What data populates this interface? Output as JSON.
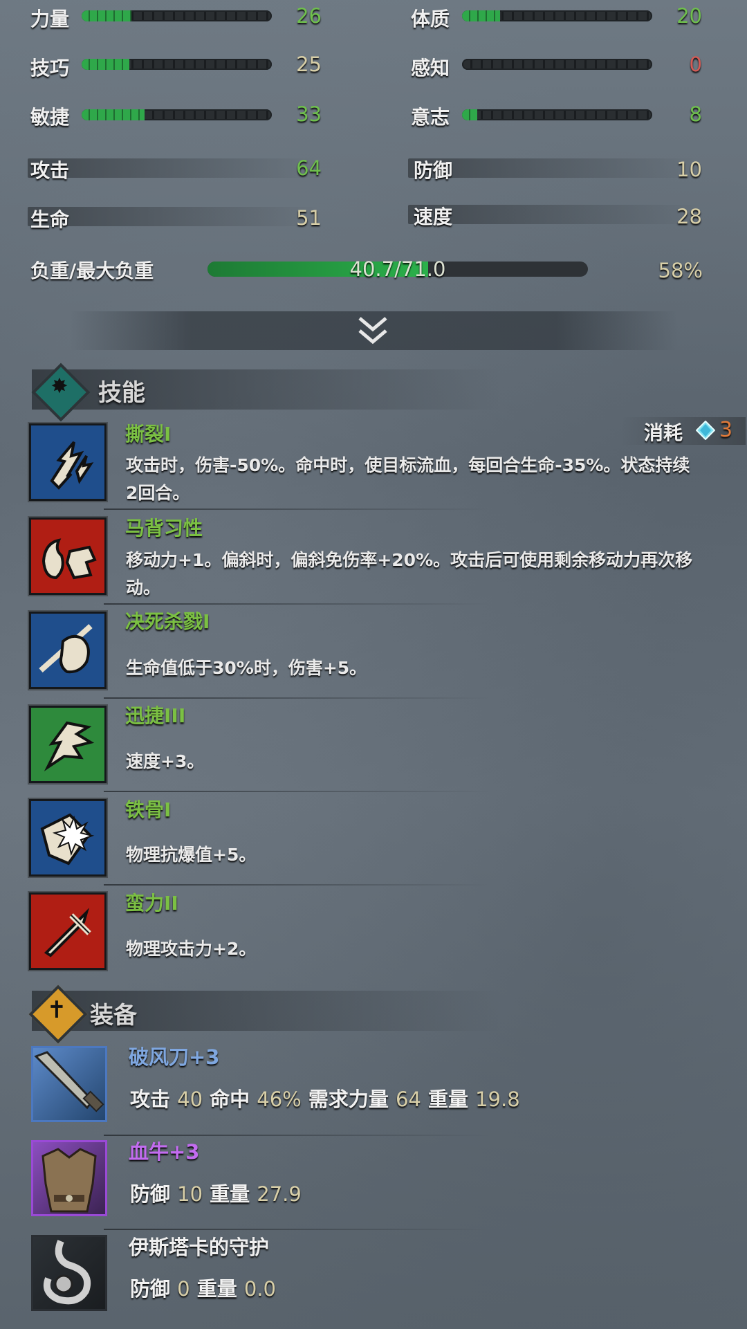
{
  "stats": {
    "left": [
      {
        "label": "力量",
        "value": "26",
        "color": "green",
        "fill": 0.26
      },
      {
        "label": "技巧",
        "value": "25",
        "color": "tan",
        "fill": 0.25
      },
      {
        "label": "敏捷",
        "value": "33",
        "color": "green",
        "fill": 0.33
      }
    ],
    "right": [
      {
        "label": "体质",
        "value": "20",
        "color": "green",
        "fill": 0.2
      },
      {
        "label": "感知",
        "value": "0",
        "color": "red",
        "fill": 0
      },
      {
        "label": "意志",
        "value": "8",
        "color": "green",
        "fill": 0.08
      }
    ],
    "attack": {
      "label": "攻击",
      "value": "64"
    },
    "defense": {
      "label": "防御",
      "value": "10"
    },
    "hp": {
      "label": "生命",
      "value": "51"
    },
    "speed": {
      "label": "速度",
      "value": "28"
    }
  },
  "load": {
    "label": "负重/最大负重",
    "text": "40.7/71.0",
    "percent": "58%",
    "fill": 0.58
  },
  "skills": {
    "title": "技能",
    "cost_label": "消耗",
    "cost_value": "3",
    "items": [
      {
        "name": "撕裂I",
        "desc": "攻击时，伤害-50%。命中时，使目标流血，每回合生命-35%。状态持续2回合。",
        "icon": "tear-icon",
        "bg": "#1f4e8c"
      },
      {
        "name": "马背习性",
        "desc": "移动力+1。偏斜时，偏斜免伤率+20%。攻击后可使用剩余移动力再次移动。",
        "icon": "horse-icon",
        "bg": "#b01e14"
      },
      {
        "name": "决死杀戮I",
        "desc": "生命值低于30%时，伤害+5。",
        "icon": "fist-icon",
        "bg": "#1f4e8c"
      },
      {
        "name": "迅捷III",
        "desc": "速度+3。",
        "icon": "swift-icon",
        "bg": "#2e8a3c"
      },
      {
        "name": "铁骨I",
        "desc": "物理抗爆值+5。",
        "icon": "shield-burst-icon",
        "bg": "#1f4e8c"
      },
      {
        "name": "蛮力II",
        "desc": "物理攻击力+2。",
        "icon": "sword-icon",
        "bg": "#b01e14"
      }
    ]
  },
  "equipment": {
    "title": "装备",
    "items": [
      {
        "name": "破风刀+3",
        "color": "#7fa7e0",
        "stats": [
          [
            "攻击",
            "40"
          ],
          [
            "命中",
            "46%"
          ],
          [
            "需求力量",
            "64"
          ],
          [
            "重量",
            "19.8"
          ]
        ],
        "icon": "blade-icon",
        "frame": "#4c78c0"
      },
      {
        "name": "血牛+3",
        "color": "#c36cf0",
        "stats": [
          [
            "防御",
            "10"
          ],
          [
            "重量",
            "27.9"
          ]
        ],
        "icon": "armor-icon",
        "frame": "#9a4ad6"
      },
      {
        "name": "伊斯塔卡的守护",
        "color": "#efefef",
        "stats": [
          [
            "防御",
            "0"
          ],
          [
            "重量",
            "0.0"
          ]
        ],
        "icon": "amulet-icon",
        "frame": "#2a2e33"
      }
    ]
  }
}
